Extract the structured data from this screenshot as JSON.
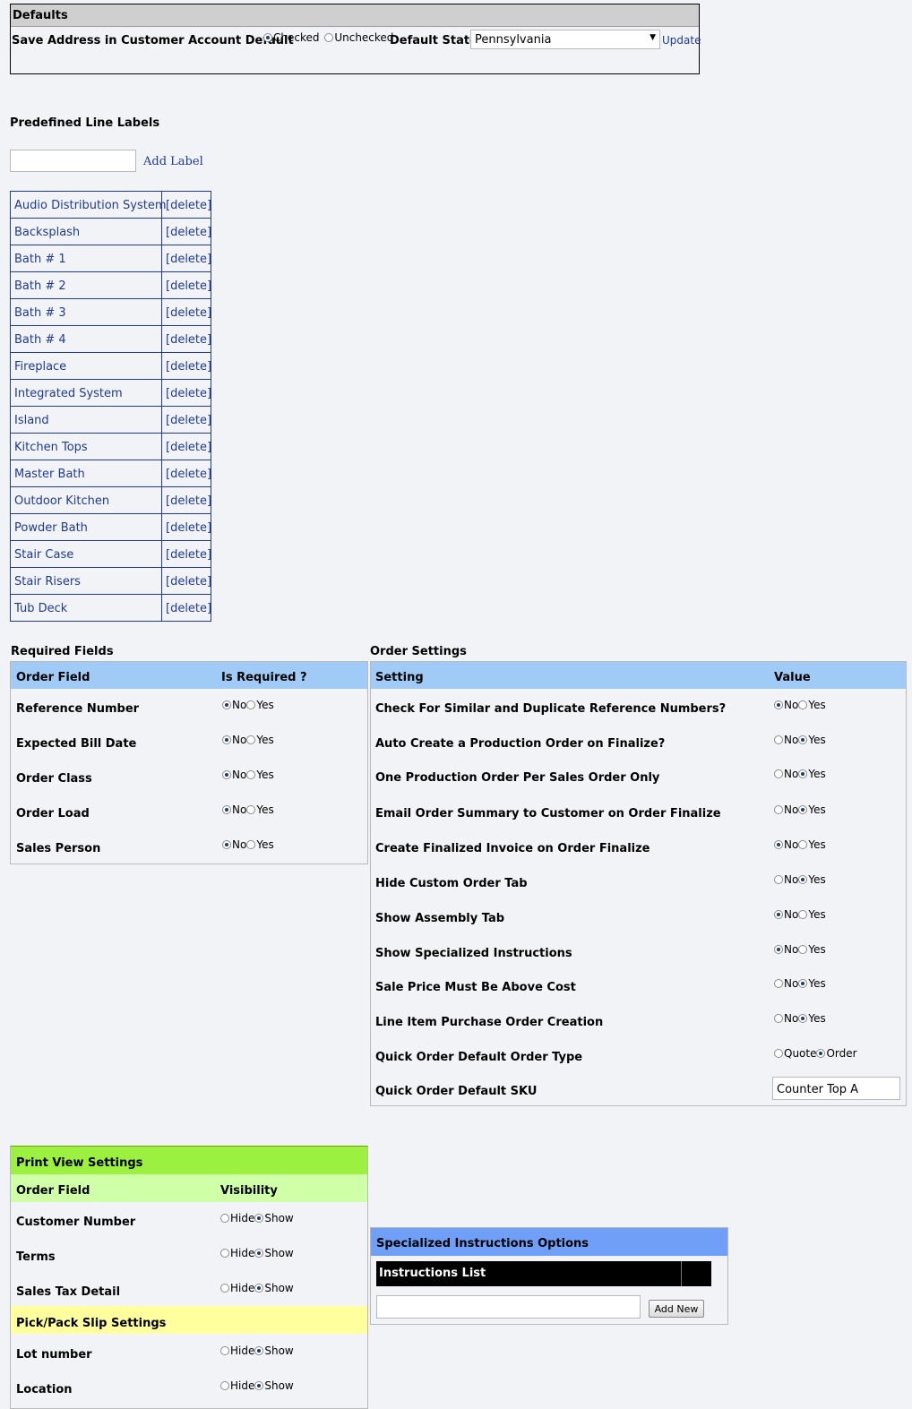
{
  "defaults": {
    "title": "Defaults",
    "save_address_label": "Save Address in Customer Account Default",
    "checked_label": "Checked",
    "unchecked_label": "Unchecked",
    "save_address_value": "Checked",
    "default_state_label": "Default State",
    "default_state_value": "Pennsylvania",
    "update_link": "Update"
  },
  "predefined_labels": {
    "title": "Predefined Line Labels",
    "add_label_link": "Add Label",
    "input_value": "",
    "delete_text": "[delete]",
    "items": [
      "Audio Distribution System",
      "Backsplash",
      "Bath # 1",
      "Bath # 2",
      "Bath # 3",
      "Bath # 4",
      "Fireplace",
      "Integrated System",
      "Island",
      "Kitchen Tops",
      "Master Bath",
      "Outdoor Kitchen",
      "Powder Bath",
      "Stair Case",
      "Stair Risers",
      "Tub Deck"
    ]
  },
  "required_fields": {
    "title": "Required Fields",
    "col_field": "Order Field",
    "col_required": "Is Required ?",
    "no_label": "No",
    "yes_label": "Yes",
    "rows": [
      {
        "label": "Reference Number",
        "value": "No"
      },
      {
        "label": "Expected Bill Date",
        "value": "No"
      },
      {
        "label": "Order Class",
        "value": "No"
      },
      {
        "label": "Order Load",
        "value": "No"
      },
      {
        "label": "Sales Person",
        "value": "No"
      }
    ]
  },
  "order_settings": {
    "title": "Order Settings",
    "col_setting": "Setting",
    "col_value": "Value",
    "no_label": "No",
    "yes_label": "Yes",
    "quote_label": "Quote",
    "order_label": "Order",
    "rows": [
      {
        "label": "Check For Similar and Duplicate Reference Numbers?",
        "value": "No"
      },
      {
        "label": "Auto Create a Production Order on Finalize?",
        "value": "Yes"
      },
      {
        "label": "One Production Order Per Sales Order Only",
        "value": "Yes"
      },
      {
        "label": "Email Order Summary to Customer on Order Finalize",
        "value": "Yes"
      },
      {
        "label": "Create Finalized Invoice on Order Finalize",
        "value": "No"
      },
      {
        "label": "Hide Custom Order Tab",
        "value": "Yes"
      },
      {
        "label": "Show Assembly Tab",
        "value": "No"
      },
      {
        "label": "Show Specialized Instructions",
        "value": "No"
      },
      {
        "label": "Sale Price Must Be Above Cost",
        "value": "Yes"
      },
      {
        "label": "Line Item Purchase Order Creation",
        "value": "Yes"
      }
    ],
    "quick_order_type_label": "Quick Order Default Order Type",
    "quick_order_type_value": "Order",
    "quick_order_sku_label": "Quick Order Default SKU",
    "quick_order_sku_value": "Counter Top A"
  },
  "print_view": {
    "title": "Print View Settings",
    "col_field": "Order Field",
    "col_visibility": "Visibility",
    "hide_label": "Hide",
    "show_label": "Show",
    "rows": [
      {
        "label": "Customer Number",
        "value": "Show"
      },
      {
        "label": "Terms",
        "value": "Show"
      },
      {
        "label": "Sales Tax Detail",
        "value": "Show"
      }
    ],
    "pick_pack_title": "Pick/Pack Slip Settings",
    "pick_pack_rows": [
      {
        "label": "Lot number",
        "value": "Show"
      },
      {
        "label": "Location",
        "value": "Show"
      }
    ]
  },
  "specialized": {
    "title": "Specialized Instructions Options",
    "list_header": "Instructions List",
    "input_value": "",
    "add_new_button": "Add New"
  }
}
